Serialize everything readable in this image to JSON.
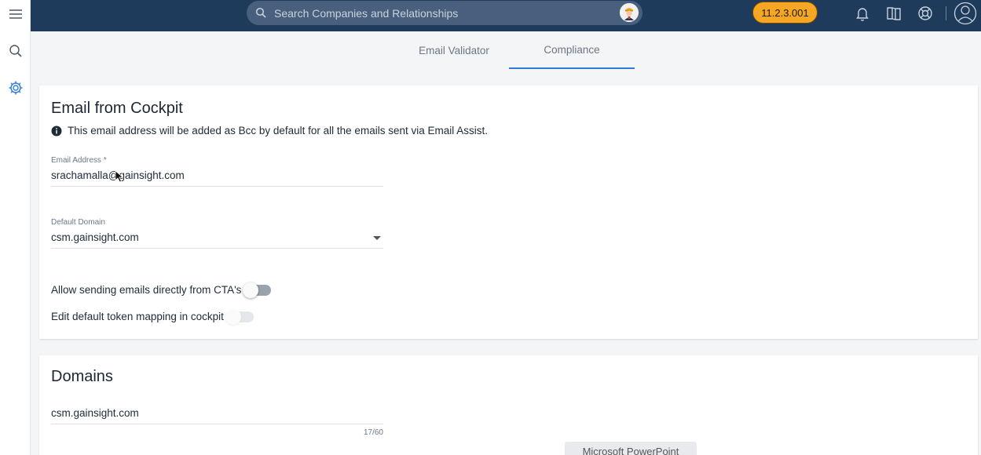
{
  "search": {
    "placeholder": "Search Companies and Relationships"
  },
  "header": {
    "version": "11.2.3.001"
  },
  "tabs": [
    {
      "label": "Email Validator"
    },
    {
      "label": "Compliance",
      "active": true
    }
  ],
  "email_section": {
    "title": "Email from Cockpit",
    "info": "This email address will be added as Bcc by default for all the emails sent via Email Assist.",
    "email_label": "Email Address *",
    "email_value": "srachamalla@gainsight.com",
    "domain_label": "Default Domain",
    "domain_value": "csm.gainsight.com",
    "toggle1_label": "Allow sending emails directly from CTA's",
    "toggle1_on": false,
    "toggle2_label": "Edit default token mapping in cockpit",
    "toggle2_on": false
  },
  "domains_section": {
    "title": "Domains",
    "domain_value": "csm.gainsight.com",
    "counter": "17/60",
    "tooltip": "Microsoft PowerPoint"
  },
  "colors": {
    "topbar": "#1f3b5c",
    "accent": "#2d7dd2",
    "version_badge": "#f5a623"
  }
}
